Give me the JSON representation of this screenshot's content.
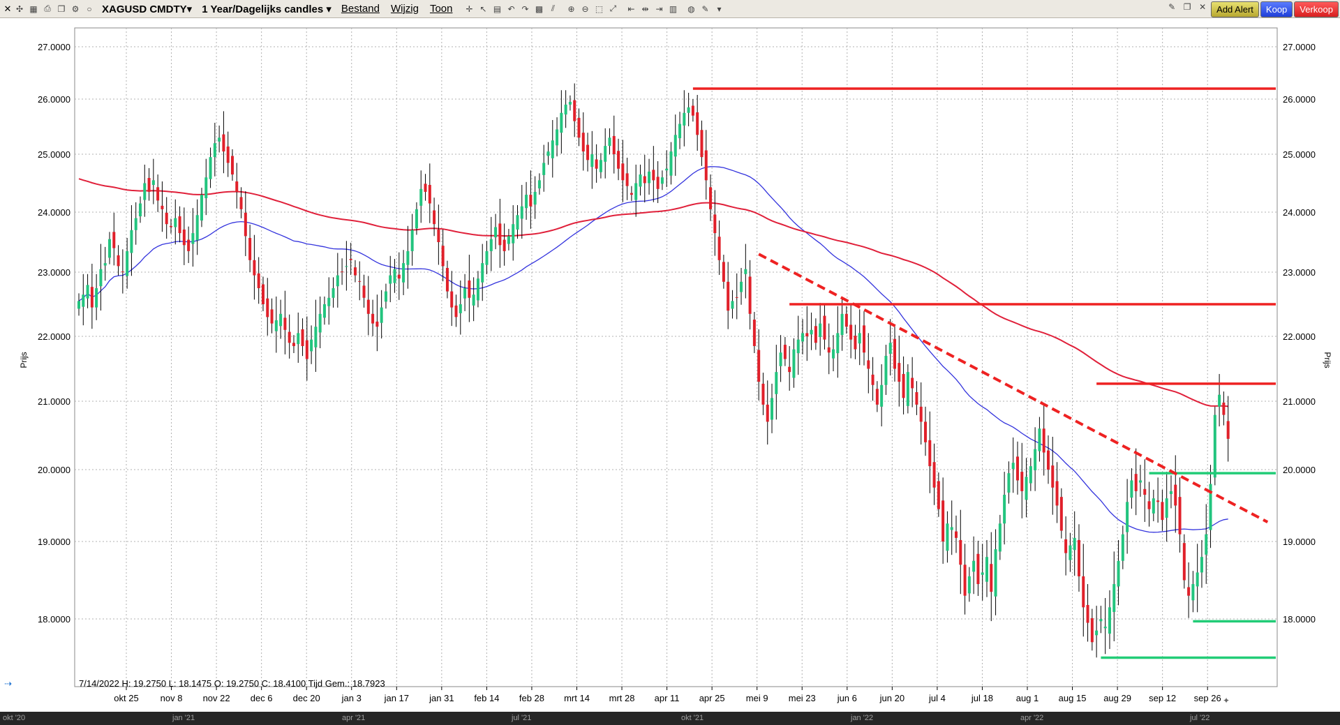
{
  "toolbar": {
    "symbol": "XAGUSD CMDTY▾",
    "period": "1 Year/Dagelijks candles ▾",
    "menu_file": "Bestand",
    "menu_edit": "Wijzig",
    "menu_view": "Toon",
    "add_alert": "Add Alert",
    "buy": "Koop",
    "sell": "Verkoop"
  },
  "colors": {
    "up": "#22c47e",
    "down": "#e0202a",
    "ma_short": "#3333dd",
    "ma_long": "#e0203a",
    "resistance": "#ee2222",
    "support": "#22cc77",
    "grid": "#b0b0b0"
  },
  "chart_data": {
    "type": "candlestick",
    "ylabel": "Prijs",
    "ylim": [
      17.4,
      27.3
    ],
    "yticks": [
      "18.0000",
      "19.0000",
      "20.0000",
      "21.0000",
      "22.0000",
      "23.0000",
      "24.0000",
      "25.0000",
      "26.0000",
      "27.0000"
    ],
    "xticks": [
      "okt 25",
      "nov 8",
      "nov 22",
      "dec 6",
      "dec 20",
      "jan 3",
      "jan 17",
      "jan 31",
      "feb 14",
      "feb 28",
      "mrt 14",
      "mrt 28",
      "apr 11",
      "apr 25",
      "mei 9",
      "mei 23",
      "jun 6",
      "jun 20",
      "jul 4",
      "jul 18",
      "aug 1",
      "aug 15",
      "aug 29",
      "sep 12",
      "sep 26"
    ],
    "info": "7/14/2022  H: 19.2750   L: 18.1475   O: 19.2750   C: 18.4100   Tijd Gem.: 18.7923",
    "overview_labels": [
      "okt '20",
      "jan '21",
      "apr '21",
      "jul '21",
      "okt '21",
      "jan '22",
      "apr '22",
      "jul '22"
    ],
    "closes": [
      22.55,
      22.65,
      22.8,
      22.45,
      22.75,
      23.05,
      23.15,
      23.55,
      23.4,
      23.1,
      23.0,
      23.35,
      23.7,
      23.9,
      24.15,
      24.5,
      24.35,
      24.55,
      24.2,
      24.05,
      23.8,
      23.75,
      23.9,
      23.65,
      23.45,
      23.35,
      23.65,
      23.95,
      24.3,
      24.6,
      24.95,
      25.2,
      25.3,
      25.05,
      24.85,
      24.65,
      24.35,
      24.05,
      23.6,
      23.2,
      22.95,
      22.75,
      22.5,
      22.3,
      22.2,
      22.25,
      22.35,
      22.1,
      21.9,
      21.85,
      22.05,
      21.85,
      21.65,
      21.95,
      22.15,
      22.35,
      22.5,
      22.6,
      22.75,
      22.95,
      23.0,
      23.1,
      23.2,
      22.95,
      22.85,
      22.6,
      22.35,
      22.2,
      22.15,
      22.45,
      22.7,
      22.95,
      23.05,
      22.9,
      23.15,
      23.35,
      23.7,
      24.05,
      24.4,
      24.35,
      24.15,
      23.8,
      23.5,
      23.1,
      22.7,
      22.45,
      22.3,
      22.5,
      22.75,
      22.6,
      22.65,
      22.9,
      23.15,
      23.35,
      23.55,
      23.75,
      23.45,
      23.35,
      23.6,
      23.8,
      23.95,
      24.1,
      24.3,
      24.1,
      24.35,
      24.55,
      24.85,
      25.05,
      25.25,
      25.45,
      25.75,
      25.9,
      25.95,
      25.6,
      25.3,
      25.05,
      24.9,
      25.0,
      24.75,
      24.9,
      25.15,
      25.3,
      25.0,
      24.75,
      24.55,
      24.45,
      24.3,
      24.5,
      24.65,
      24.5,
      24.7,
      24.55,
      24.4,
      24.6,
      24.75,
      25.05,
      25.35,
      25.55,
      25.75,
      25.85,
      25.7,
      25.35,
      24.95,
      24.55,
      24.05,
      23.65,
      23.2,
      22.85,
      22.4,
      22.55,
      22.6,
      22.85,
      23.05,
      22.35,
      21.85,
      21.3,
      20.95,
      20.7,
      21.05,
      21.45,
      21.75,
      21.65,
      21.45,
      21.8,
      21.95,
      22.05,
      22.0,
      22.1,
      21.9,
      22.2,
      21.95,
      21.75,
      21.8,
      22.05,
      22.35,
      22.15,
      21.95,
      21.8,
      22.05,
      21.75,
      21.5,
      21.25,
      20.95,
      21.25,
      21.7,
      21.9,
      21.5,
      21.3,
      21.05,
      21.45,
      21.2,
      20.95,
      20.7,
      20.4,
      20.05,
      19.75,
      19.45,
      19.0,
      19.25,
      19.2,
      19.05,
      18.7,
      18.3,
      18.55,
      18.75,
      18.45,
      18.6,
      18.8,
      18.35,
      18.9,
      19.25,
      19.65,
      19.95,
      20.1,
      19.85,
      19.7,
      19.9,
      20.05,
      20.3,
      20.6,
      20.25,
      20.0,
      19.75,
      19.5,
      19.15,
      18.85,
      18.95,
      19.05,
      18.55,
      18.15,
      17.95,
      17.7,
      17.85,
      18.0,
      17.9,
      18.15,
      18.45,
      18.75,
      19.1,
      19.55,
      19.85,
      19.7,
      19.85,
      19.65,
      19.45,
      19.6,
      19.55,
      19.3,
      19.6,
      19.7,
      19.5,
      19.1,
      18.5,
      18.3,
      18.45,
      18.6,
      18.8,
      19.1,
      19.8,
      20.8,
      21.1,
      20.8,
      20.45
    ]
  },
  "overlays": {
    "ma_short_period": 50,
    "ma_long_period": 200,
    "resistance_lines": [
      {
        "price": 26.2,
        "from_candle": 140,
        "to_candle": "end"
      },
      {
        "price": 22.5,
        "from_candle": 162,
        "to_candle": "end"
      },
      {
        "price": 21.27,
        "from_candle": 232,
        "to_candle": "end"
      }
    ],
    "support_lines": [
      {
        "price": 19.95,
        "from_candle": 244,
        "to_candle": "end"
      },
      {
        "price": 17.97,
        "from_candle": 254,
        "to_candle": "end"
      },
      {
        "price": 17.5,
        "from_candle": 233,
        "to_candle": "end"
      }
    ],
    "trendline": {
      "from_candle": 155,
      "from_price": 23.3,
      "to_candle": 271,
      "to_price": 19.27
    }
  }
}
